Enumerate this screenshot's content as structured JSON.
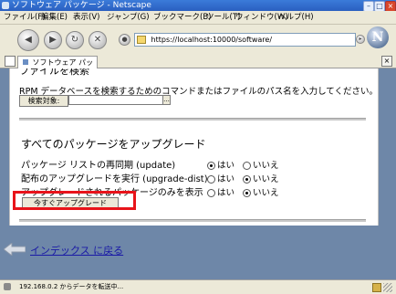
{
  "window": {
    "title": "ソフトウェア パッケージ - Netscape"
  },
  "menu": [
    "ファイル(F)",
    "編集(E)",
    "表示(V)",
    "ジャンプ(G)",
    "ブックマーク(B)",
    "ツール(T)",
    "ウィンドウ(W)",
    "ヘルプ(H)"
  ],
  "address": {
    "url": "https://localhost:10000/software/"
  },
  "tab": {
    "label": "ソフトウェア パッケージ",
    "close": "×"
  },
  "content": {
    "prev_heading": "ファイルを検索",
    "rpm_text": "RPM データベースを検索するためのコマンドまたはファイルのパス名を入力してください。",
    "search_button": "検索対象:",
    "browse_button": "...",
    "upgrade_heading": "すべてのパッケージをアップグレード",
    "options": [
      {
        "label": "パッケージ リストの再同期 (update)",
        "yes": "はい",
        "no": "いいえ",
        "selected": "yes"
      },
      {
        "label": "配布のアップグレードを実行 (upgrade-dist)",
        "yes": "はい",
        "no": "いいえ",
        "selected": "no"
      },
      {
        "label": "アップグレードされるパッケージのみを表示",
        "yes": "はい",
        "no": "いいえ",
        "selected": "no"
      }
    ],
    "upgrade_button": "今すぐアップグレード",
    "highlight_color": "#e8141a"
  },
  "footer": {
    "index_link": "インデックス に戻る"
  },
  "status": {
    "text": "192.168.0.2 からデータを転送中..."
  }
}
